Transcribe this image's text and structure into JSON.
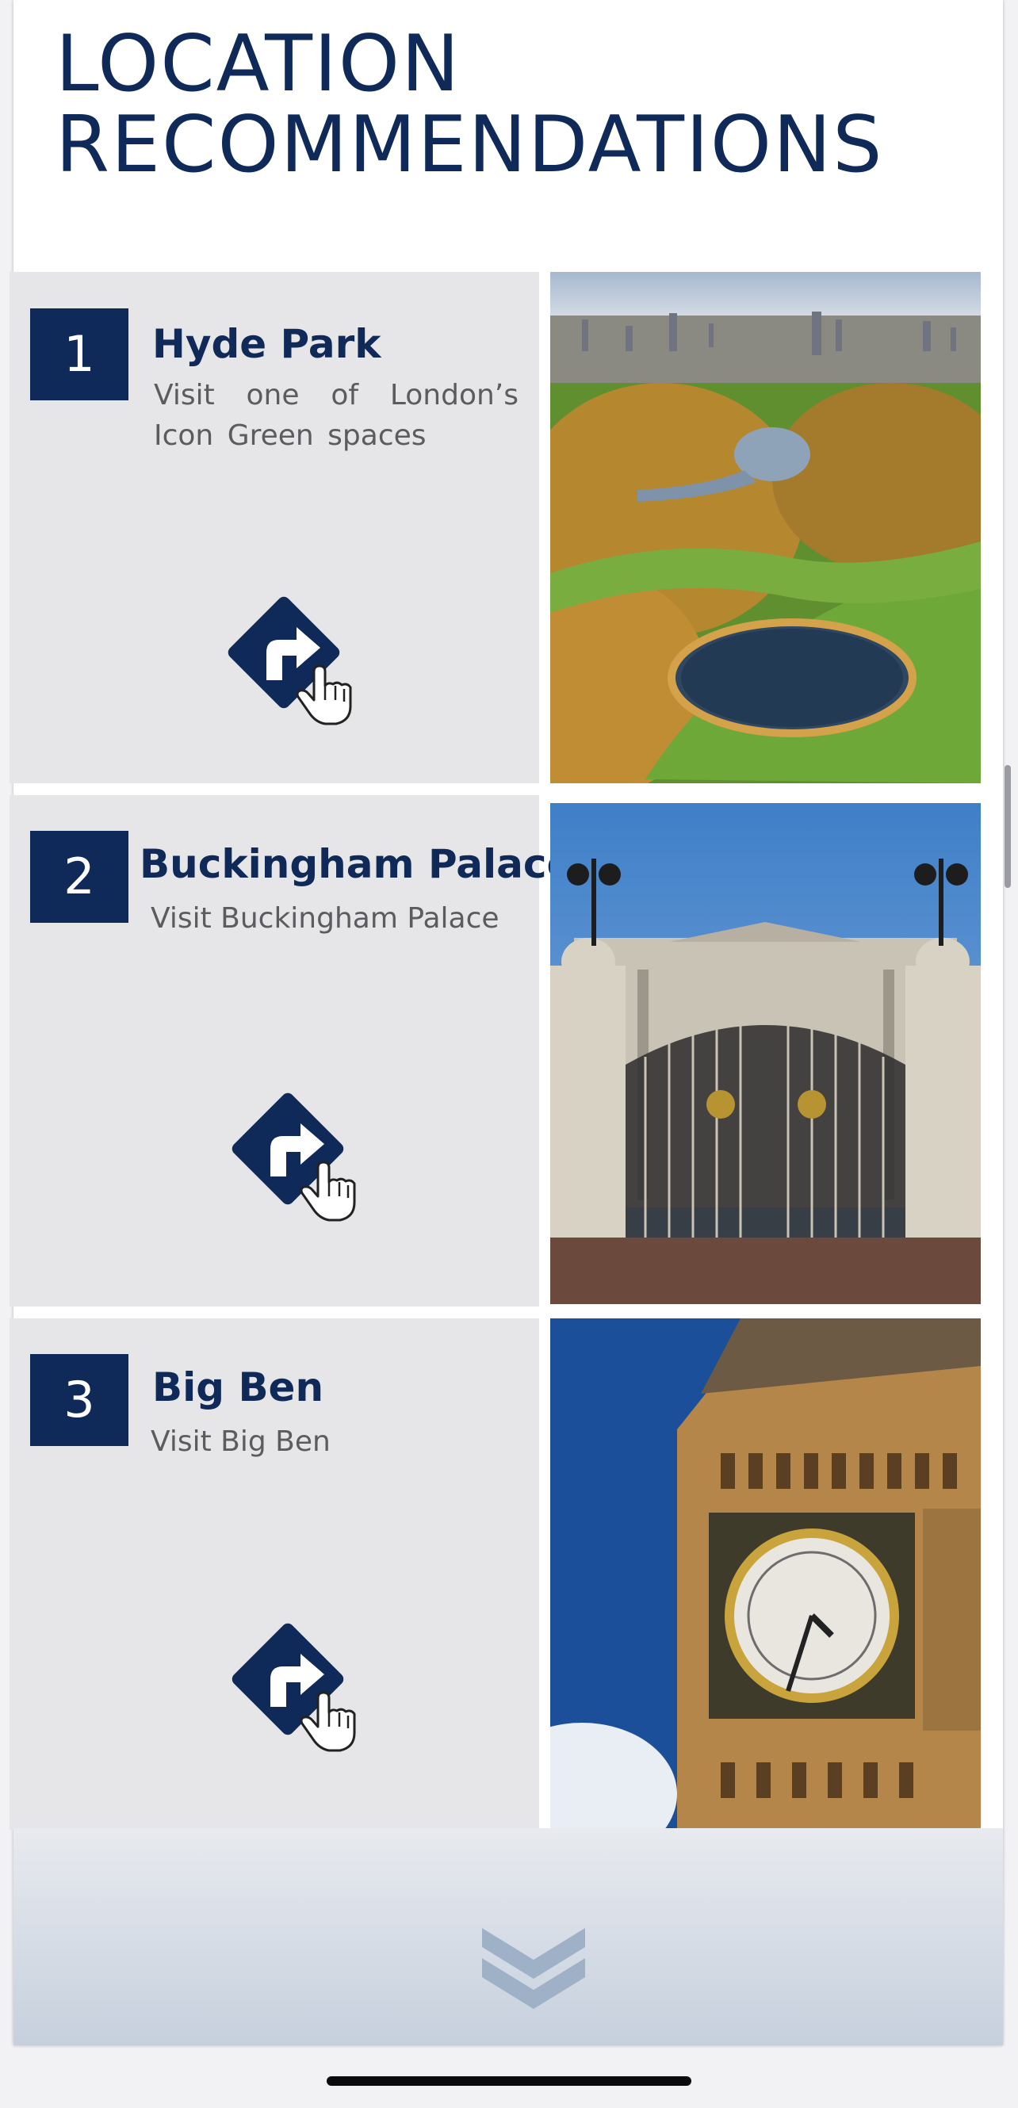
{
  "page": {
    "title_line1": "LOCATION",
    "title_line2": "RECOMMENDATIONS"
  },
  "colors": {
    "brand_navy": "#0f2a58",
    "card_bg": "#e6e6e8",
    "desc_text": "#5b5b60"
  },
  "locations": [
    {
      "number": "1",
      "title": "Hyde Park",
      "description": "Visit one of London’s Icon Green spaces",
      "action_icon": "directions-turn-right-icon",
      "photo": "hyde-park-aerial-photo"
    },
    {
      "number": "2",
      "title": "Buckingham Palace",
      "description": "Visit Buckingham Palace",
      "action_icon": "directions-turn-right-icon",
      "photo": "buckingham-palace-gates-photo"
    },
    {
      "number": "3",
      "title": "Big Ben",
      "description": "Visit Big Ben",
      "action_icon": "directions-turn-right-icon",
      "photo": "big-ben-clock-tower-photo"
    }
  ],
  "footer": {
    "scroll_icon": "double-chevron-down-icon"
  }
}
